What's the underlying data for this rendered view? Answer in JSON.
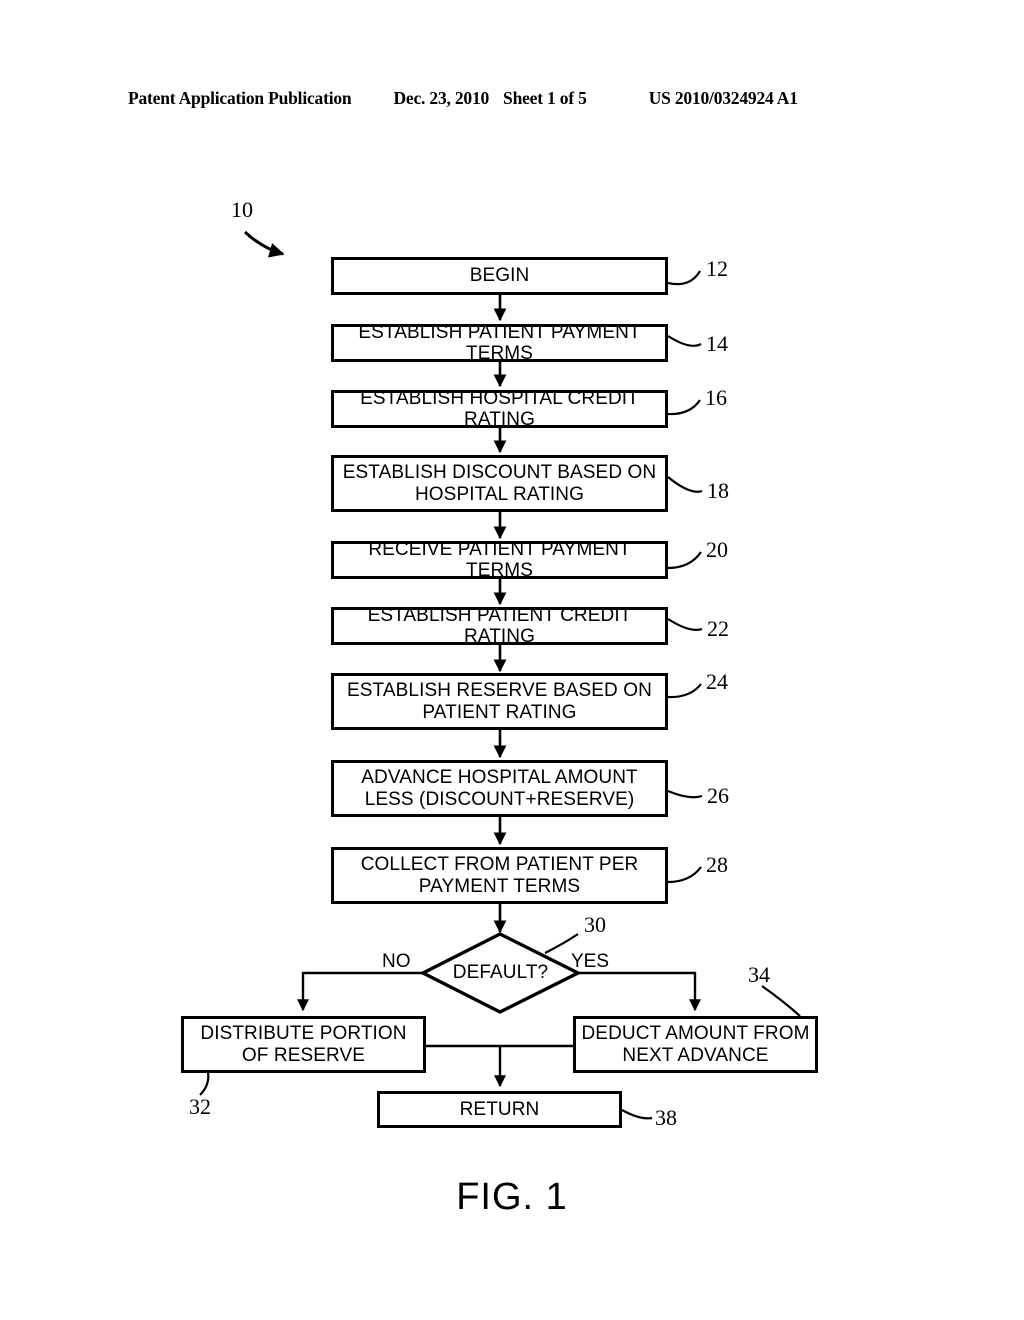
{
  "header": {
    "publication": "Patent Application Publication",
    "date": "Dec. 23, 2010",
    "sheet": "Sheet 1 of 5",
    "patent_number": "US 2010/0324924 A1"
  },
  "figure": {
    "caption": "FIG. 1",
    "overall_ref": "10",
    "branch_no": "NO",
    "branch_yes": "YES",
    "nodes": [
      {
        "ref": "12",
        "text": "BEGIN"
      },
      {
        "ref": "14",
        "text": "ESTABLISH PATIENT PAYMENT TERMS"
      },
      {
        "ref": "16",
        "text": "ESTABLISH HOSPITAL CREDIT RATING"
      },
      {
        "ref": "18",
        "text": "ESTABLISH DISCOUNT BASED ON\nHOSPITAL RATING"
      },
      {
        "ref": "20",
        "text": "RECEIVE PATIENT PAYMENT TERMS"
      },
      {
        "ref": "22",
        "text": "ESTABLISH PATIENT CREDIT RATING"
      },
      {
        "ref": "24",
        "text": "ESTABLISH RESERVE BASED ON\nPATIENT RATING"
      },
      {
        "ref": "26",
        "text": "ADVANCE HOSPITAL AMOUNT\nLESS (DISCOUNT+RESERVE)"
      },
      {
        "ref": "28",
        "text": "COLLECT FROM PATIENT PER\nPAYMENT TERMS"
      },
      {
        "ref": "30",
        "text": "DEFAULT?"
      },
      {
        "ref": "32",
        "text": "DISTRIBUTE PORTION\nOF RESERVE"
      },
      {
        "ref": "34",
        "text": "DEDUCT AMOUNT FROM\nNEXT ADVANCE"
      },
      {
        "ref": "38",
        "text": "RETURN"
      }
    ]
  },
  "colors": {
    "ink": "#000000",
    "paper": "#ffffff"
  }
}
